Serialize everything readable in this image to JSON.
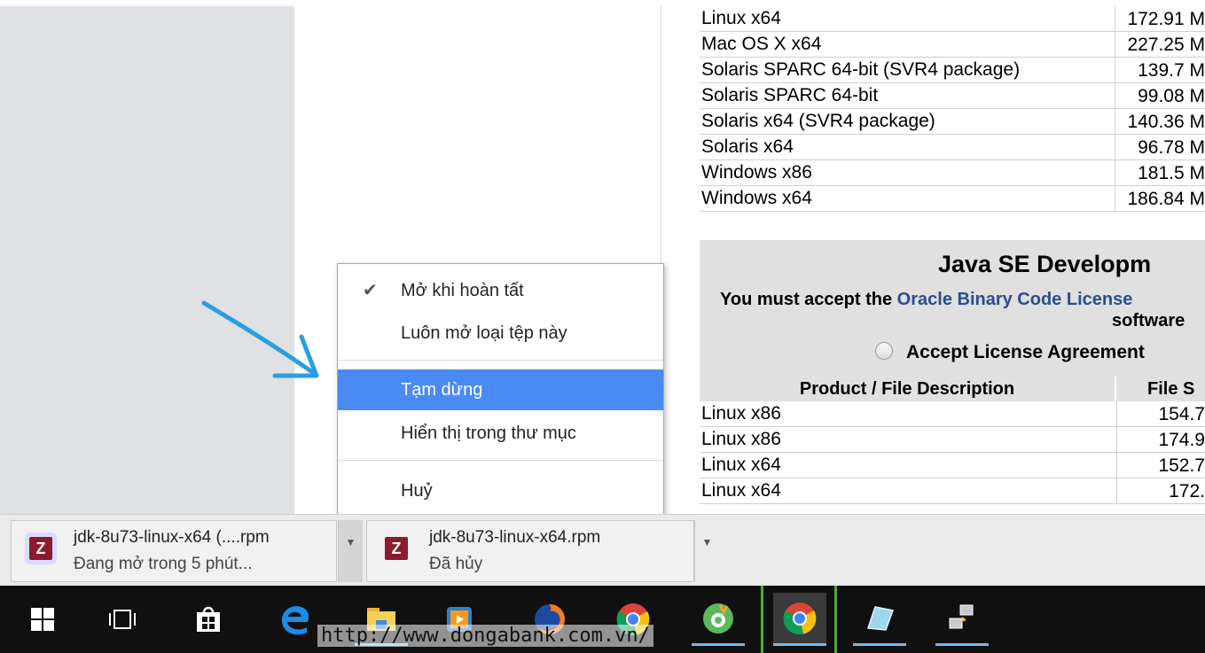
{
  "table_top": [
    {
      "desc": "Linux x64",
      "size": "172.91 M"
    },
    {
      "desc": "Mac OS X x64",
      "size": "227.25 M"
    },
    {
      "desc": "Solaris SPARC 64-bit (SVR4 package)",
      "size": "139.7 M"
    },
    {
      "desc": "Solaris SPARC 64-bit",
      "size": "99.08 M"
    },
    {
      "desc": "Solaris x64 (SVR4 package)",
      "size": "140.36 M"
    },
    {
      "desc": "Solaris x64",
      "size": "96.78 M"
    },
    {
      "desc": "Windows x86",
      "size": "181.5 M"
    },
    {
      "desc": "Windows x64",
      "size": "186.84 M"
    }
  ],
  "java_section": {
    "title": "Java SE Developm",
    "line1_prefix": "You must accept the ",
    "line1_link": "Oracle Binary Code License",
    "line2": "software",
    "accept_label": "Accept License Agreement"
  },
  "table_header": {
    "col1": "Product / File Description",
    "col2": "File S"
  },
  "table_bottom": [
    {
      "desc": "Linux x86",
      "size": "154.7"
    },
    {
      "desc": "Linux x86",
      "size": "174.9"
    },
    {
      "desc": "Linux x64",
      "size": "152.7"
    },
    {
      "desc": "Linux x64",
      "size": "172."
    }
  ],
  "context_menu": {
    "items": [
      {
        "label": "Mở khi hoàn tất",
        "checked": true
      },
      {
        "label": "Luôn mở loại tệp này"
      },
      {
        "label": "Tạm dừng",
        "selected": true
      },
      {
        "label": "Hiển thị trong thư mục"
      },
      {
        "label": "Huỷ"
      }
    ]
  },
  "downloads": [
    {
      "name": "jdk-8u73-linux-x64 (....rpm",
      "status": "Đang mở trong 5 phút..."
    },
    {
      "name": "jdk-8u73-linux-x64.rpm",
      "status": "Đã hủy"
    }
  ],
  "taskbar_icons": [
    "windows-start-icon",
    "task-view-icon",
    "store-icon",
    "edge-icon",
    "file-explorer-icon",
    "media-player-icon",
    "firefox-icon",
    "chrome-icon",
    "coccoc-icon",
    "chrome-icon",
    "glass-app-icon",
    "network-app-icon"
  ],
  "overlay_url": "http://www.dongabank.com.vn/",
  "colors": {
    "menu_highlight": "#4a8af4",
    "link": "#2a4f8f",
    "annotation_arrow": "#2a9fe0"
  }
}
